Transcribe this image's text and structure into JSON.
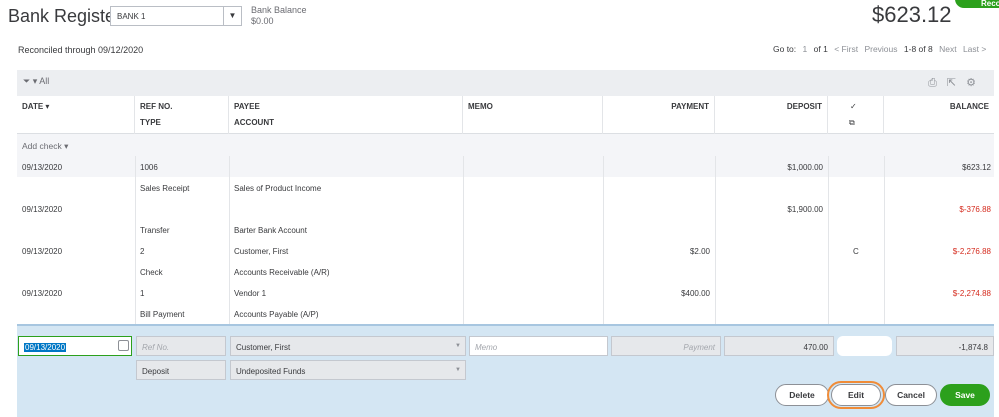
{
  "header": {
    "title": "Bank Register",
    "account": "BANK 1",
    "bank_balance_label": "Bank Balance",
    "bank_balance_value": "$0.00",
    "register_balance": "$623.12",
    "reconcile_label": "Reconcile"
  },
  "status": {
    "reconciled_through": "Reconciled through 09/12/2020"
  },
  "pager": {
    "goto_label": "Go to:",
    "page": "1",
    "of_label": "of 1",
    "first": "< First",
    "previous": "Previous",
    "range": "1-8 of 8",
    "next": "Next",
    "last": "Last >"
  },
  "toolbar": {
    "filter_label": "All"
  },
  "columns": {
    "date": "DATE",
    "ref": "REF NO.",
    "type": "TYPE",
    "payee": "PAYEE",
    "account": "ACCOUNT",
    "memo": "MEMO",
    "payment": "PAYMENT",
    "deposit": "DEPOSIT",
    "balance": "BALANCE"
  },
  "add_check": "Add check",
  "rows": [
    {
      "date": "09/13/2020",
      "ref": "1006",
      "type": "Sales Receipt",
      "payee": "",
      "account": "Sales of Product Income",
      "memo": "",
      "payment": "",
      "deposit": "$1,000.00",
      "cleared": "",
      "balance": "$623.12",
      "negative": false
    },
    {
      "date": "09/13/2020",
      "ref": "",
      "type": "Transfer",
      "payee": "",
      "account": "Barter Bank Account",
      "memo": "",
      "payment": "",
      "deposit": "$1,900.00",
      "cleared": "",
      "balance": "$-376.88",
      "negative": true
    },
    {
      "date": "09/13/2020",
      "ref": "2",
      "type": "Check",
      "payee": "Customer, First",
      "account": "Accounts Receivable (A/R)",
      "memo": "",
      "payment": "$2.00",
      "deposit": "",
      "cleared": "C",
      "balance": "$-2,276.88",
      "negative": true
    },
    {
      "date": "09/13/2020",
      "ref": "1",
      "type": "Bill Payment",
      "payee": "Vendor 1",
      "account": "Accounts Payable (A/P)",
      "memo": "",
      "payment": "$400.00",
      "deposit": "",
      "cleared": "",
      "balance": "$-2,274.88",
      "negative": true
    }
  ],
  "edit_row": {
    "date": "09/13/2020",
    "ref_placeholder": "Ref No.",
    "payee": "Customer, First",
    "memo_placeholder": "Memo",
    "payment_placeholder": "Payment",
    "deposit": "470.00",
    "balance": "-1,874.8",
    "type": "Deposit",
    "account": "Undeposited Funds"
  },
  "actions": {
    "delete": "Delete",
    "edit": "Edit",
    "cancel": "Cancel",
    "save": "Save"
  },
  "colors": {
    "accent_green": "#2ca01c",
    "negative_red": "#d52b1e",
    "highlight_orange": "#f08c38",
    "edit_bg": "#d4e6f3"
  }
}
